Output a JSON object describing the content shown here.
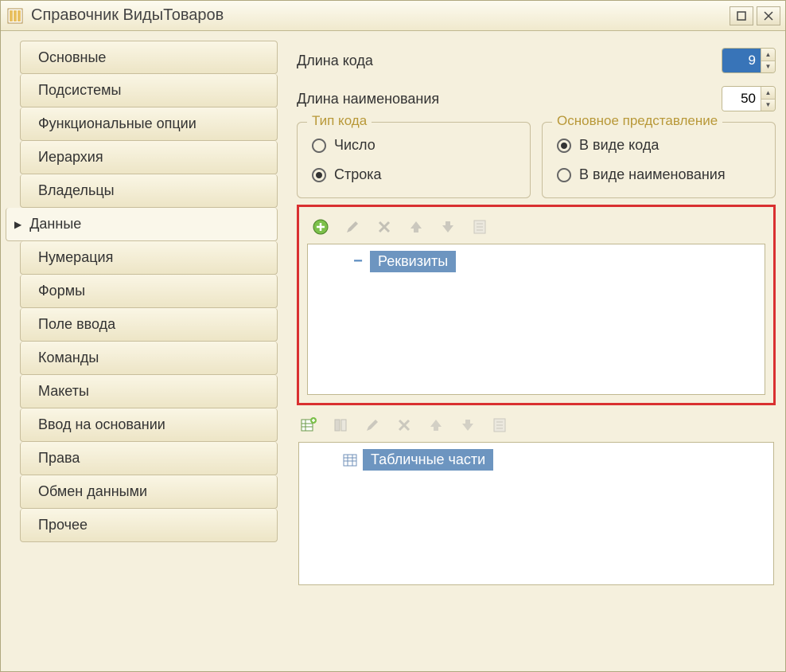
{
  "window": {
    "title": "Справочник ВидыТоваров"
  },
  "sidebar": {
    "items": [
      {
        "label": "Основные"
      },
      {
        "label": "Подсистемы"
      },
      {
        "label": "Функциональные опции"
      },
      {
        "label": "Иерархия"
      },
      {
        "label": "Владельцы"
      },
      {
        "label": "Данные"
      },
      {
        "label": "Нумерация"
      },
      {
        "label": "Формы"
      },
      {
        "label": "Поле ввода"
      },
      {
        "label": "Команды"
      },
      {
        "label": "Макеты"
      },
      {
        "label": "Ввод на основании"
      },
      {
        "label": "Права"
      },
      {
        "label": "Обмен данными"
      },
      {
        "label": "Прочее"
      }
    ],
    "active_index": 5
  },
  "fields": {
    "code_length": {
      "label": "Длина кода",
      "value": "9"
    },
    "name_length": {
      "label": "Длина наименования",
      "value": "50"
    }
  },
  "groups": {
    "code_type": {
      "legend": "Тип кода",
      "options": [
        {
          "label": "Число",
          "checked": false
        },
        {
          "label": "Строка",
          "checked": true
        }
      ]
    },
    "main_presentation": {
      "legend": "Основное представление",
      "options": [
        {
          "label": "В виде кода",
          "checked": true
        },
        {
          "label": "В виде наименования",
          "checked": false
        }
      ]
    }
  },
  "attributes_panel": {
    "root_label": "Реквизиты"
  },
  "tabular_panel": {
    "root_label": "Табличные части"
  },
  "icons": {
    "add": "add-icon",
    "edit": "edit-icon",
    "delete": "delete-icon",
    "up": "up-icon",
    "down": "down-icon",
    "list": "list-icon",
    "add_table": "add-table-icon",
    "add_col": "add-column-icon"
  }
}
